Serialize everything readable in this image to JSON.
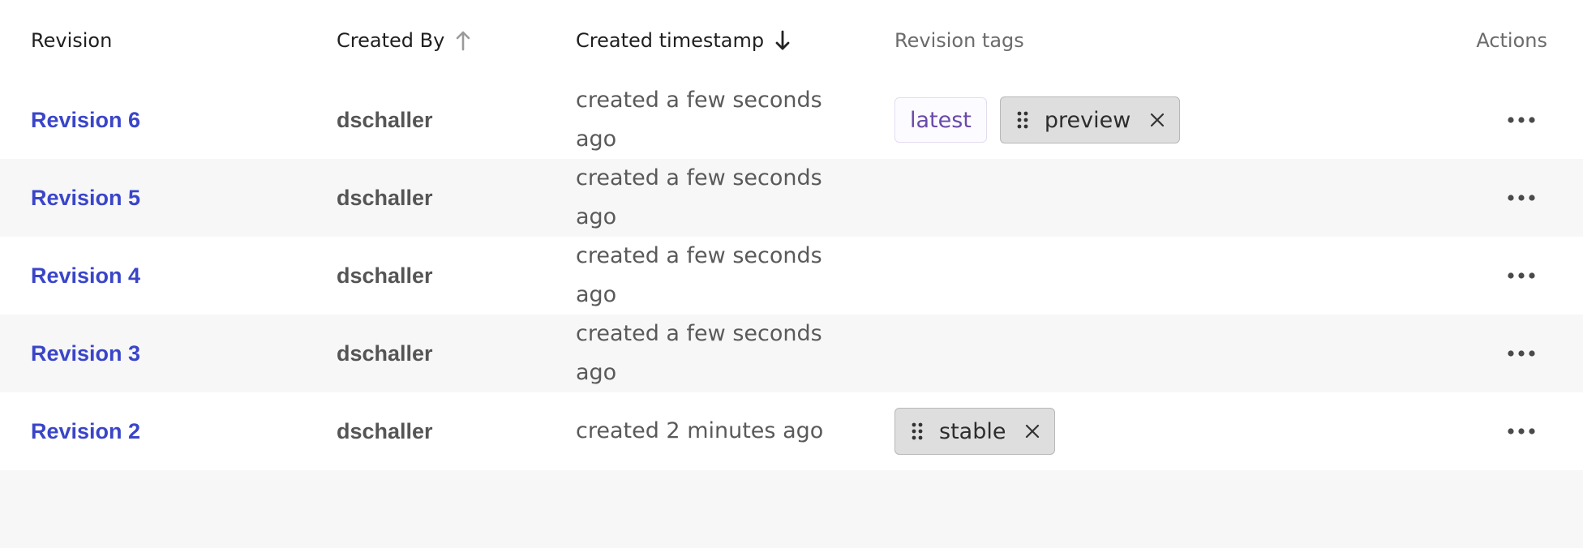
{
  "headers": {
    "revision": "Revision",
    "created_by": "Created By",
    "created_timestamp": "Created timestamp",
    "revision_tags": "Revision tags",
    "actions": "Actions"
  },
  "sort": {
    "created_by_icon": "arrow-up-icon",
    "created_timestamp_icon": "arrow-down-icon"
  },
  "colors": {
    "link": "#3a45c9",
    "latest_tag_text": "#6a4aa8",
    "chip_bg": "#dedede",
    "row_alt_bg": "#f7f7f7"
  },
  "rows": [
    {
      "revision": "Revision 6",
      "created_by": "dschaller",
      "timestamp": "created a few seconds ago",
      "tags": [
        "latest",
        "preview"
      ]
    },
    {
      "revision": "Revision 5",
      "created_by": "dschaller",
      "timestamp": "created a few seconds ago",
      "tags": []
    },
    {
      "revision": "Revision 4",
      "created_by": "dschaller",
      "timestamp": "created a few seconds ago",
      "tags": []
    },
    {
      "revision": "Revision 3",
      "created_by": "dschaller",
      "timestamp": "created a few seconds ago",
      "tags": []
    },
    {
      "revision": "Revision 2",
      "created_by": "dschaller",
      "timestamp": "created 2 minutes ago",
      "tags": [
        "stable"
      ]
    }
  ]
}
